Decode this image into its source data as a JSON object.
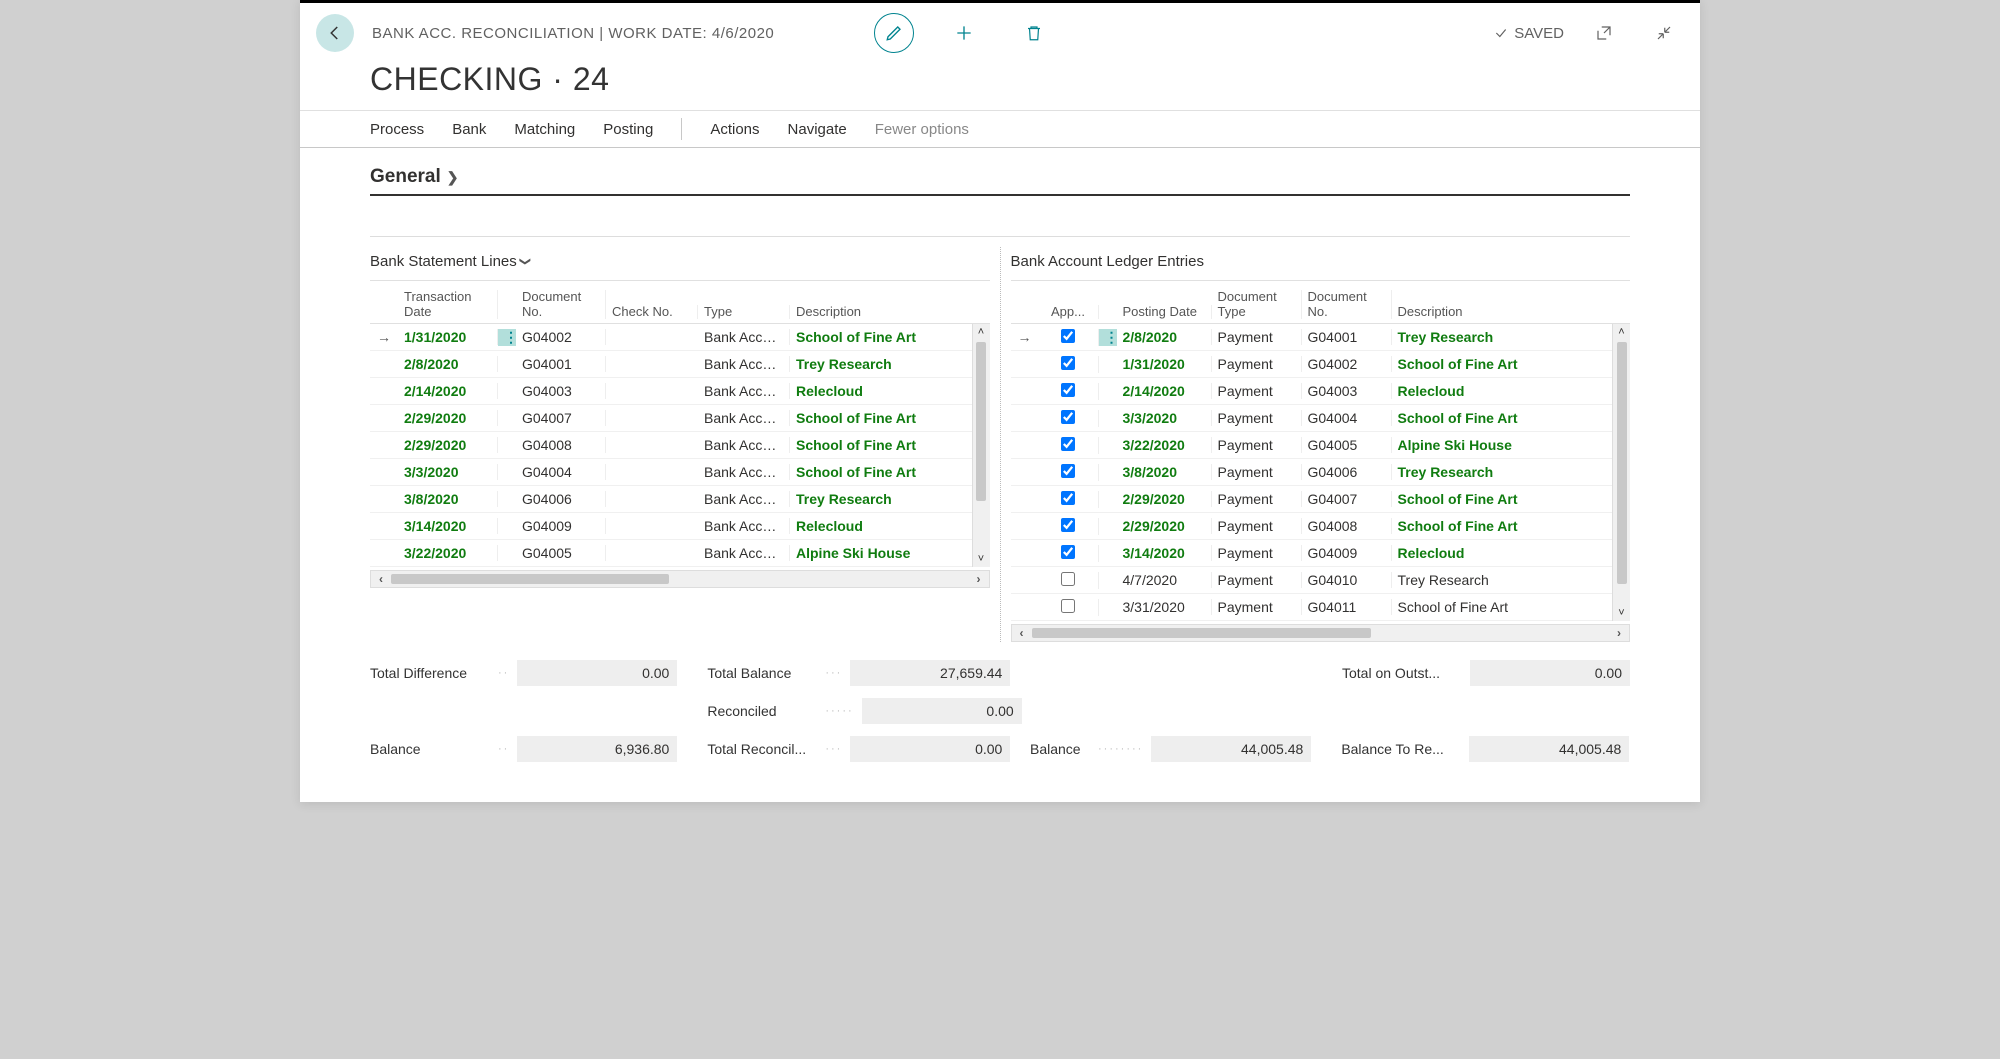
{
  "header": {
    "breadcrumb": "BANK ACC. RECONCILIATION | WORK DATE: 4/6/2020",
    "title": "CHECKING · 24",
    "saved": "SAVED"
  },
  "menu": {
    "process": "Process",
    "bank": "Bank",
    "matching": "Matching",
    "posting": "Posting",
    "actions": "Actions",
    "navigate": "Navigate",
    "fewer": "Fewer options"
  },
  "section_general": "General",
  "left": {
    "title": "Bank Statement Lines",
    "headers": {
      "trans_date1": "Transaction",
      "trans_date2": "Date",
      "doc1": "Document",
      "doc2": "No.",
      "check": "Check No.",
      "type": "Type",
      "desc": "Description"
    },
    "rows": [
      {
        "date": "1/31/2020",
        "doc": "G04002",
        "type": "Bank Account",
        "desc": "School of Fine Art",
        "selected": true
      },
      {
        "date": "2/8/2020",
        "doc": "G04001",
        "type": "Bank Accou...",
        "desc": "Trey Research"
      },
      {
        "date": "2/14/2020",
        "doc": "G04003",
        "type": "Bank Accou...",
        "desc": "Relecloud"
      },
      {
        "date": "2/29/2020",
        "doc": "G04007",
        "type": "Bank Accou...",
        "desc": "School of Fine Art"
      },
      {
        "date": "2/29/2020",
        "doc": "G04008",
        "type": "Bank Accou...",
        "desc": "School of Fine Art"
      },
      {
        "date": "3/3/2020",
        "doc": "G04004",
        "type": "Bank Accou...",
        "desc": "School of Fine Art"
      },
      {
        "date": "3/8/2020",
        "doc": "G04006",
        "type": "Bank Accou...",
        "desc": "Trey Research"
      },
      {
        "date": "3/14/2020",
        "doc": "G04009",
        "type": "Bank Accou...",
        "desc": "Relecloud"
      },
      {
        "date": "3/22/2020",
        "doc": "G04005",
        "type": "Bank Accou...",
        "desc": "Alpine Ski House"
      }
    ]
  },
  "right": {
    "title": "Bank Account Ledger Entries",
    "headers": {
      "app": "App...",
      "pdate": "Posting Date",
      "dtype1": "Document",
      "dtype2": "Type",
      "dno1": "Document",
      "dno2": "No.",
      "desc": "Description"
    },
    "rows": [
      {
        "app": true,
        "date": "2/8/2020",
        "dtype": "Payment",
        "dno": "G04001",
        "desc": "Trey Research",
        "matched": true,
        "selected": true
      },
      {
        "app": true,
        "date": "1/31/2020",
        "dtype": "Payment",
        "dno": "G04002",
        "desc": "School of Fine Art",
        "matched": true
      },
      {
        "app": true,
        "date": "2/14/2020",
        "dtype": "Payment",
        "dno": "G04003",
        "desc": "Relecloud",
        "matched": true
      },
      {
        "app": true,
        "date": "3/3/2020",
        "dtype": "Payment",
        "dno": "G04004",
        "desc": "School of Fine Art",
        "matched": true
      },
      {
        "app": true,
        "date": "3/22/2020",
        "dtype": "Payment",
        "dno": "G04005",
        "desc": "Alpine Ski House",
        "matched": true
      },
      {
        "app": true,
        "date": "3/8/2020",
        "dtype": "Payment",
        "dno": "G04006",
        "desc": "Trey Research",
        "matched": true
      },
      {
        "app": true,
        "date": "2/29/2020",
        "dtype": "Payment",
        "dno": "G04007",
        "desc": "School of Fine Art",
        "matched": true
      },
      {
        "app": true,
        "date": "2/29/2020",
        "dtype": "Payment",
        "dno": "G04008",
        "desc": "School of Fine Art",
        "matched": true
      },
      {
        "app": true,
        "date": "3/14/2020",
        "dtype": "Payment",
        "dno": "G04009",
        "desc": "Relecloud",
        "matched": true
      },
      {
        "app": false,
        "date": "4/7/2020",
        "dtype": "Payment",
        "dno": "G04010",
        "desc": "Trey Research",
        "matched": false
      },
      {
        "app": false,
        "date": "3/31/2020",
        "dtype": "Payment",
        "dno": "G04011",
        "desc": "School of Fine Art",
        "matched": false
      }
    ]
  },
  "totals": {
    "total_diff_label": "Total Difference",
    "total_diff": "0.00",
    "balance_label": "Balance",
    "balance_l": "6,936.80",
    "total_balance_label": "Total Balance",
    "total_balance": "27,659.44",
    "reconciled_label": "Reconciled",
    "reconciled": "0.00",
    "total_reconcil_label": "Total Reconcil...",
    "total_reconcil": "0.00",
    "balance_r": "44,005.48",
    "total_outst_label": "Total on Outst...",
    "total_outst": "0.00",
    "balance_tore_label": "Balance To Re...",
    "balance_tore": "44,005.48"
  }
}
